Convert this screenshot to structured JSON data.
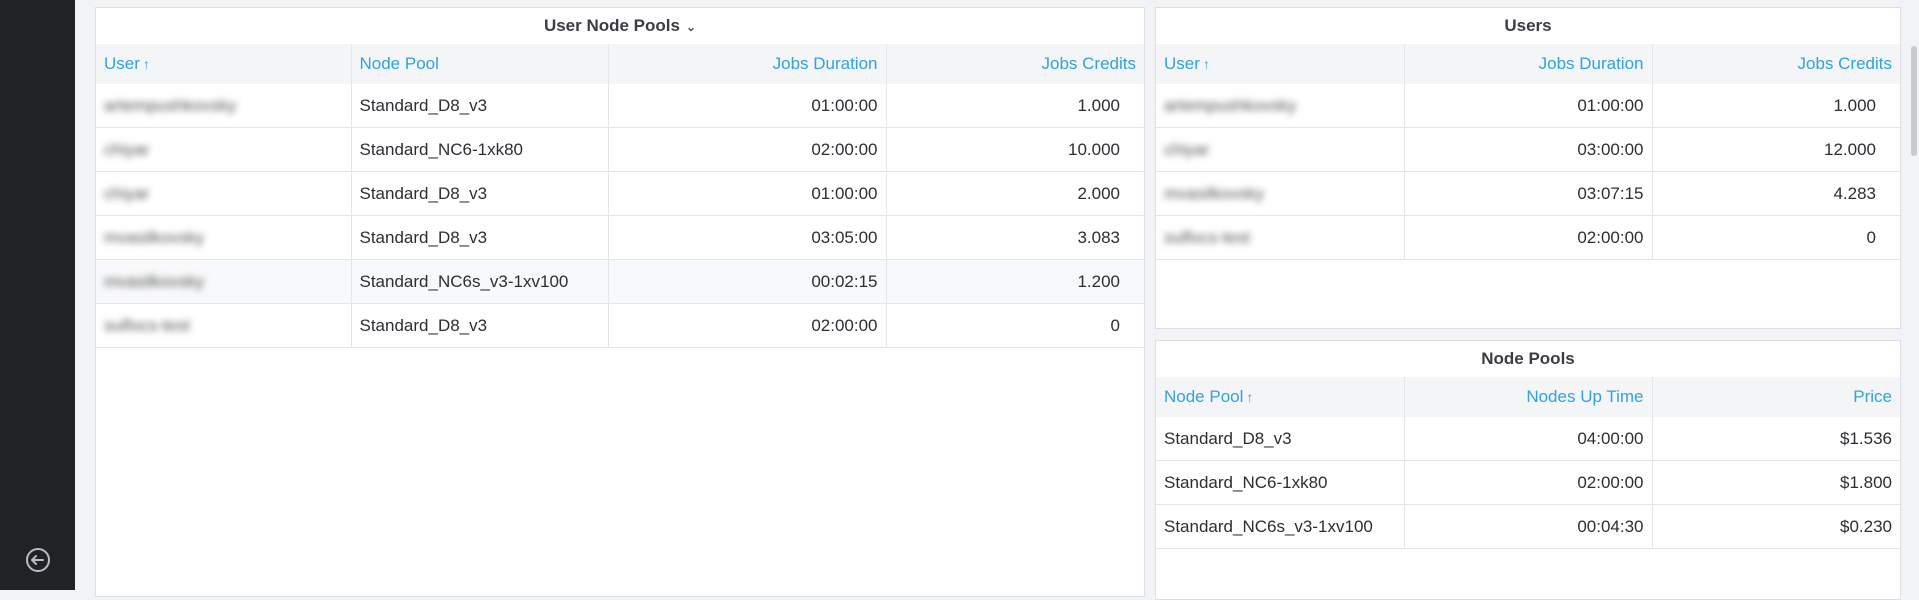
{
  "user_node_pools": {
    "title": "User Node Pools",
    "columns": [
      "User",
      "Node Pool",
      "Jobs Duration",
      "Jobs Credits"
    ],
    "rows": [
      {
        "user": "artempushkovsky",
        "node_pool": "Standard_D8_v3",
        "duration": "01:00:00",
        "credits": "1.000"
      },
      {
        "user": "chiyar",
        "node_pool": "Standard_NC6-1xk80",
        "duration": "02:00:00",
        "credits": "10.000"
      },
      {
        "user": "chiyar",
        "node_pool": "Standard_D8_v3",
        "duration": "01:00:00",
        "credits": "2.000"
      },
      {
        "user": "mvasilkovsky",
        "node_pool": "Standard_D8_v3",
        "duration": "03:05:00",
        "credits": "3.083"
      },
      {
        "user": "mvasilkovsky",
        "node_pool": "Standard_NC6s_v3-1xv100",
        "duration": "00:02:15",
        "credits": "1.200"
      },
      {
        "user": "sulfocs-test",
        "node_pool": "Standard_D8_v3",
        "duration": "02:00:00",
        "credits": "0"
      }
    ]
  },
  "users": {
    "title": "Users",
    "columns": [
      "User",
      "Jobs Duration",
      "Jobs Credits"
    ],
    "rows": [
      {
        "user": "artempushkovsky",
        "duration": "01:00:00",
        "credits": "1.000"
      },
      {
        "user": "chiyar",
        "duration": "03:00:00",
        "credits": "12.000"
      },
      {
        "user": "mvasilkovsky",
        "duration": "03:07:15",
        "credits": "4.283"
      },
      {
        "user": "sulfocs-test",
        "duration": "02:00:00",
        "credits": "0"
      }
    ]
  },
  "node_pools": {
    "title": "Node Pools",
    "columns": [
      "Node Pool",
      "Nodes Up Time",
      "Price"
    ],
    "rows": [
      {
        "node_pool": "Standard_D8_v3",
        "uptime": "04:00:00",
        "price": "$1.536"
      },
      {
        "node_pool": "Standard_NC6-1xk80",
        "uptime": "02:00:00",
        "price": "$1.800"
      },
      {
        "node_pool": "Standard_NC6s_v3-1xv100",
        "uptime": "00:04:30",
        "price": "$0.230"
      }
    ]
  },
  "icons": {
    "sort_asc": "arrow-up-icon",
    "title_menu": "chevron-down-icon",
    "exit": "sign-out-icon"
  },
  "colors": {
    "sidebar": "#202226",
    "header_link": "#2fa3db"
  }
}
